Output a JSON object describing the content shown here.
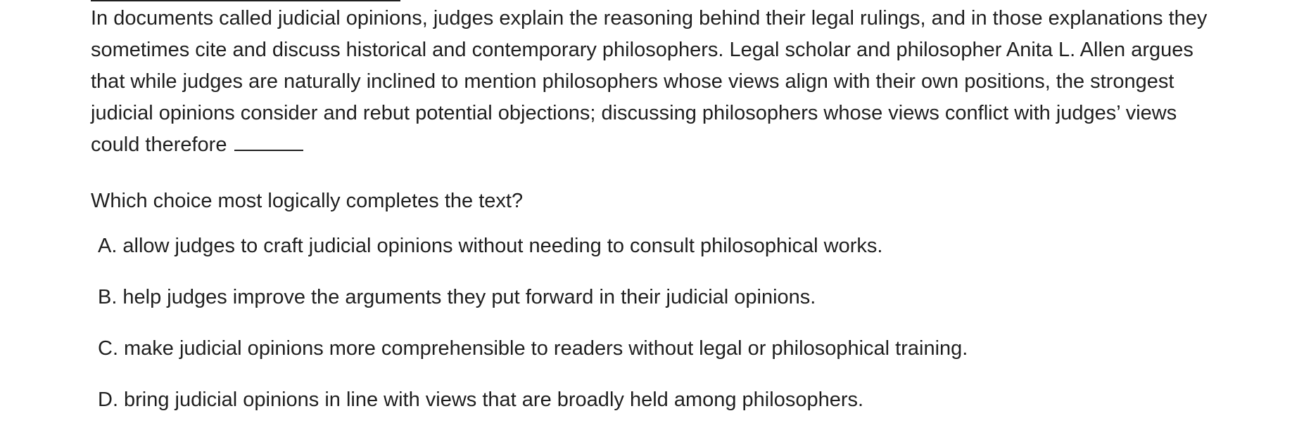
{
  "passage": {
    "text": "In documents called judicial opinions, judges explain the reasoning behind their legal rulings, and in those explanations they sometimes cite and discuss historical and contemporary philosophers. Legal scholar and philosopher Anita L. Allen argues that while judges are naturally inclined to mention philosophers whose views align with their own positions, the strongest judicial opinions consider and rebut potential objections; discussing philosophers whose views conflict with judges’ views could therefore"
  },
  "question": {
    "prompt": "Which choice most logically completes the text?"
  },
  "choices": [
    {
      "letter": "A.",
      "text": "allow judges to craft judicial opinions without needing to consult philosophical works."
    },
    {
      "letter": "B.",
      "text": "help judges improve the arguments they put forward in their judicial opinions."
    },
    {
      "letter": "C.",
      "text": "make judicial opinions more comprehensible to readers without legal or philosophical training."
    },
    {
      "letter": "D.",
      "text": "bring judicial opinions in line with views that are broadly held among philosophers."
    }
  ]
}
